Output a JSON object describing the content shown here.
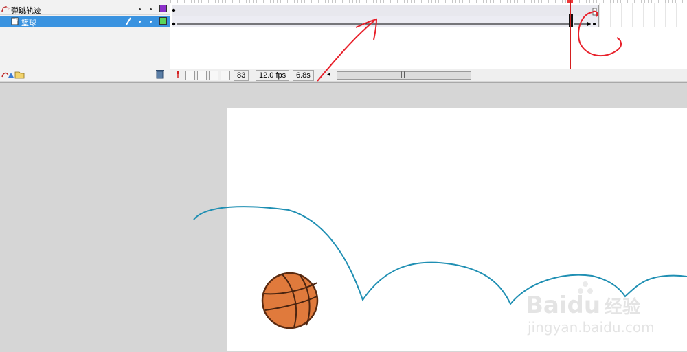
{
  "layers": [
    {
      "name": "弹跳轨迹",
      "icon": "motion-guide-icon",
      "color": "#8b2fc9",
      "selected": false
    },
    {
      "name": "篮球",
      "icon": "layer-icon",
      "color": "#5ad65a",
      "selected": true
    }
  ],
  "timeline": {
    "current_frame": "83",
    "frame_rate": "12.0 fps",
    "elapsed_time": "6.8s",
    "scroll_grip": "|||"
  },
  "colors": {
    "path_stroke": "#1f8fb3",
    "ball_fill": "#e07a3c",
    "annotation_red": "#e8202a",
    "playhead": "#d42020"
  },
  "watermark": {
    "brand": "Baidu",
    "suffix": "经验",
    "url": "jingyan.baidu.com"
  }
}
